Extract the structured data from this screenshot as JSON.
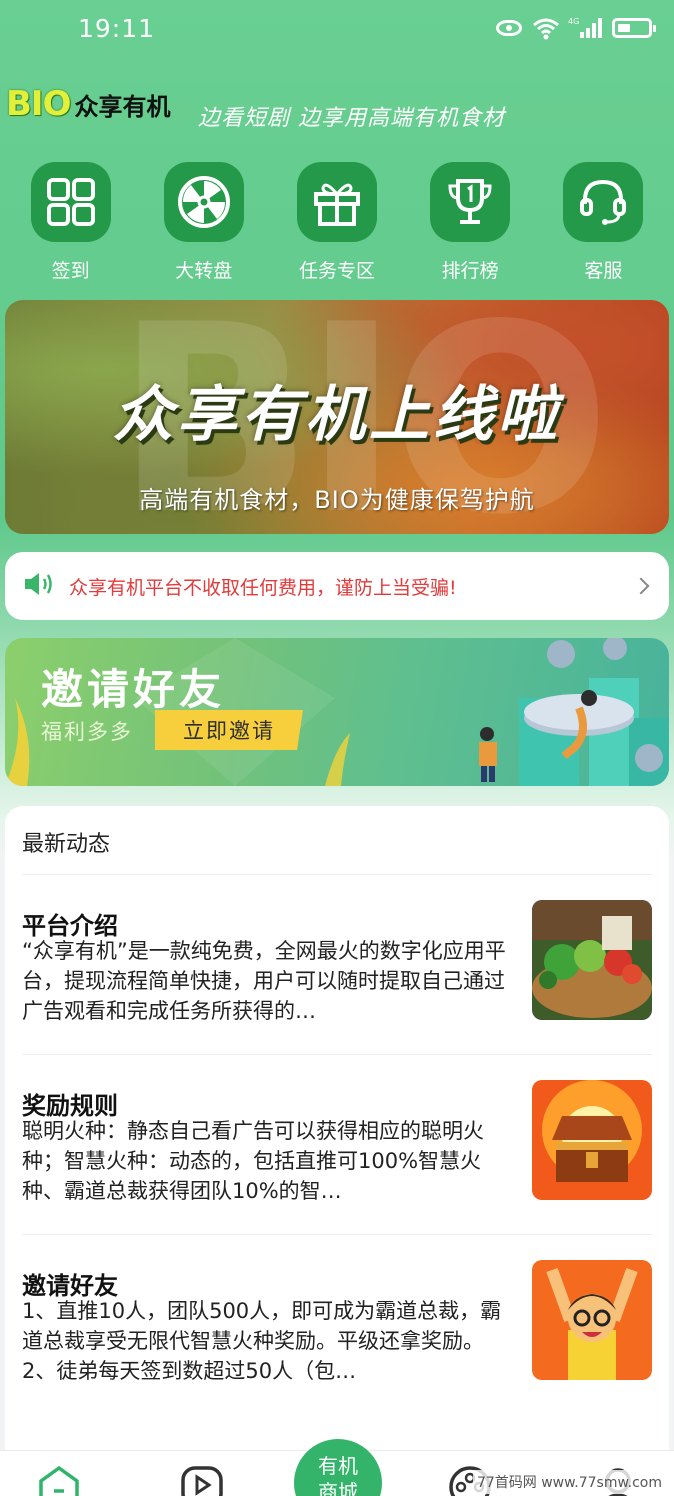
{
  "status_bar": {
    "time": "19:11",
    "network": "4G"
  },
  "brand": {
    "logo": "BIO",
    "name": "众享有机",
    "slogan": "边看短剧 边享用高端有机食材"
  },
  "quick_menu": [
    {
      "label": "签到",
      "icon": "grid-icon"
    },
    {
      "label": "大转盘",
      "icon": "wheel-icon"
    },
    {
      "label": "任务专区",
      "icon": "gift-icon"
    },
    {
      "label": "排行榜",
      "icon": "trophy-icon"
    },
    {
      "label": "客服",
      "icon": "headset-icon"
    }
  ],
  "banner": {
    "title": "众享有机上线啦",
    "subtitle": "高端有机食材，BIO为健康保驾护航",
    "watermark": "BIO"
  },
  "notice": {
    "text": "众享有机平台不收取任何费用，谨防上当受骗!"
  },
  "invite": {
    "title": "邀请好友",
    "subtitle": "福利多多",
    "button": "立即邀请"
  },
  "news": {
    "header": "最新动态",
    "items": [
      {
        "title": "平台介绍",
        "body": "“众享有机”是一款纯免费，全网最火的数字化应用平台，提现流程简单快捷，用户可以随时提取自己通过广告观看和完成任务所获得的…"
      },
      {
        "title": "奖励规则",
        "body": "聪明火种：静态自己看广告可以获得相应的聪明火种；智慧火种：动态的，包括直推可100%智慧火种、霸道总裁获得团队10%的智…"
      },
      {
        "title": "邀请好友",
        "body": "1、直推10人，团队500人，即可成为霸道总裁，霸道总裁享受无限代智慧火种奖励。平级还拿奖励。2、徒弟每天签到数超过50人（包…"
      }
    ]
  },
  "bottom_nav": {
    "center_label_1": "有机",
    "center_label_2": "商城"
  },
  "watermark": "77首码网 www.77smw.com",
  "colors": {
    "accent": "#24994a",
    "notice": "#e23b3b",
    "button": "#f7cf3d"
  }
}
